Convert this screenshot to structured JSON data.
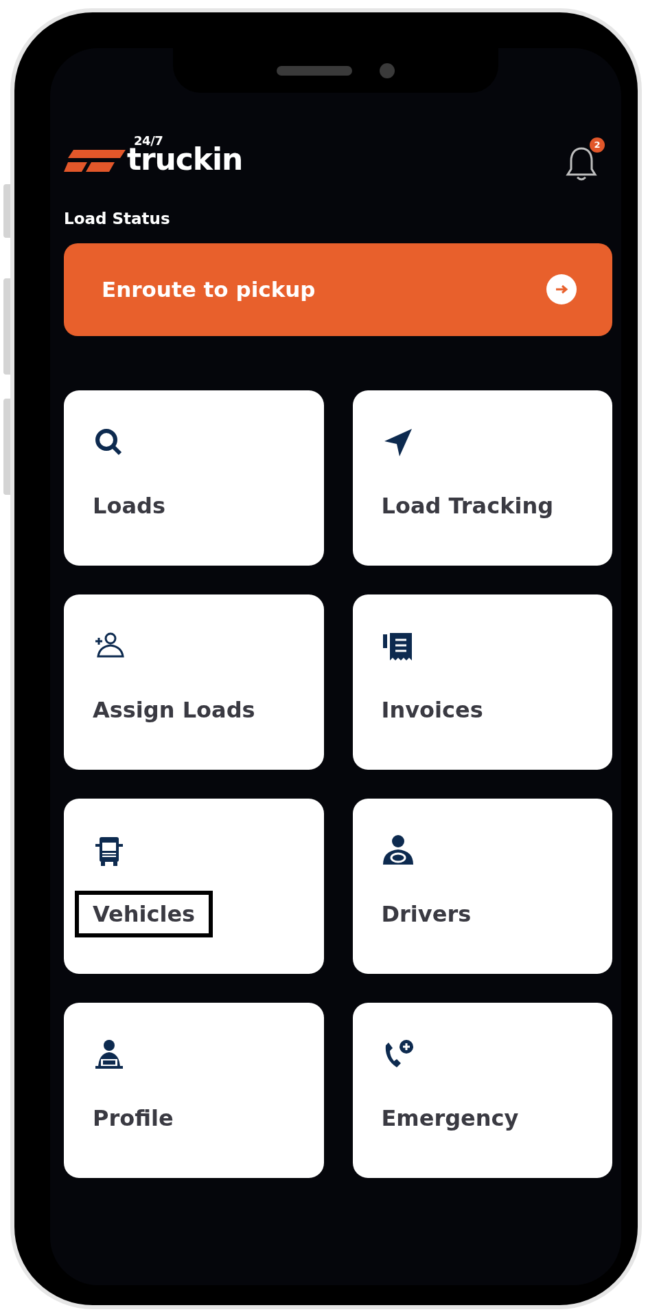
{
  "header": {
    "logo": {
      "superscript": "24/7",
      "wordmark": "truckin"
    },
    "notifications": {
      "count": "2"
    }
  },
  "load_status": {
    "label": "Load Status",
    "button": {
      "text": "Enroute to pickup"
    }
  },
  "tiles": [
    {
      "label": "Loads",
      "kind": "search",
      "highlighted": false
    },
    {
      "label": "Load Tracking",
      "kind": "navigation",
      "highlighted": false
    },
    {
      "label": "Assign Loads",
      "kind": "add-user",
      "highlighted": false
    },
    {
      "label": "Invoices",
      "kind": "receipt",
      "highlighted": false
    },
    {
      "label": "Vehicles",
      "kind": "truck",
      "highlighted": true
    },
    {
      "label": "Drivers",
      "kind": "driver",
      "highlighted": false
    },
    {
      "label": "Profile",
      "kind": "profile",
      "highlighted": false
    },
    {
      "label": "Emergency",
      "kind": "emergency-call",
      "highlighted": false
    }
  ]
}
